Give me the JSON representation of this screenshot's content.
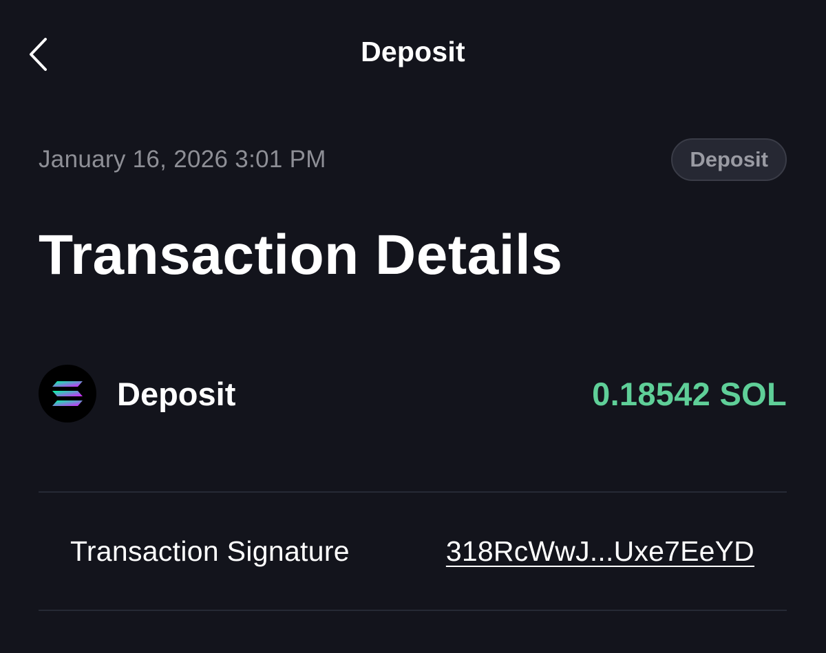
{
  "header": {
    "title": "Deposit",
    "back_icon": "chevron-left-icon"
  },
  "meta": {
    "date": "January 16, 2026 3:01 PM",
    "badge": "Deposit"
  },
  "page_title": "Transaction Details",
  "asset": {
    "icon": "solana-logo-icon",
    "label": "Deposit",
    "amount": "0.18542 SOL"
  },
  "details": {
    "signature_label": "Transaction Signature",
    "signature_value": "318RcWwJ...Uxe7EeYD"
  },
  "colors": {
    "background": "#13141c",
    "amount_green": "#5fcf98",
    "badge_bg": "#262833",
    "muted_text": "#8e8f96"
  }
}
